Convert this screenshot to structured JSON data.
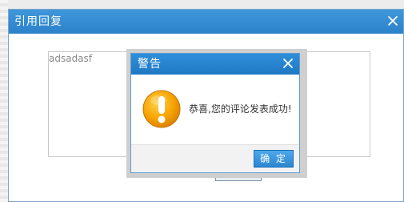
{
  "outer_dialog": {
    "title": "引用回复",
    "quote_text": "adsadasf"
  },
  "alert": {
    "title": "警告",
    "message": "恭喜,您的评论发表成功!",
    "confirm_label": "确 定"
  }
}
